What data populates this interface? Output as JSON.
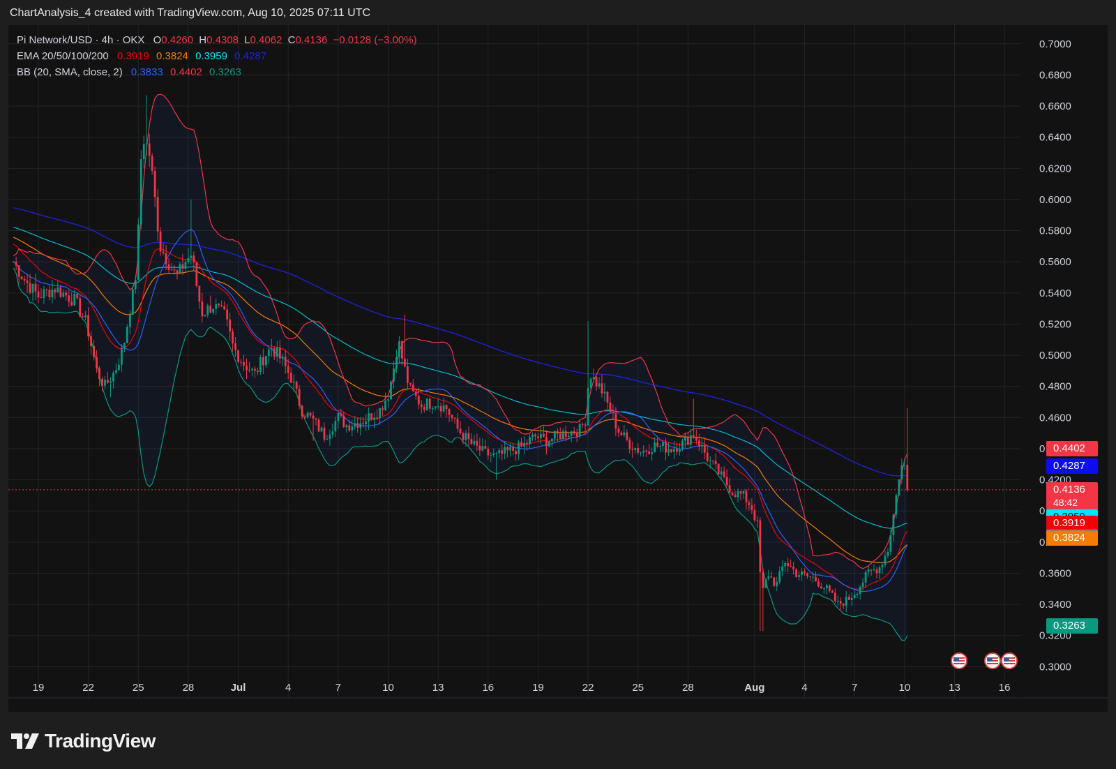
{
  "header": {
    "title": "ChartAnalysis_4 created with TradingView.com, Aug 10, 2025 07:11 UTC"
  },
  "legend": {
    "symbol": "Pi Network/USD · 4h · OKX",
    "o_label": "O",
    "o_value": "0.4260",
    "h_label": "H",
    "h_value": "0.4308",
    "l_label": "L",
    "l_value": "0.4062",
    "c_label": "C",
    "c_value": "0.4136",
    "change": "−0.0128 (−3.00%)",
    "ema_label": "EMA 20/50/100/200",
    "ema20": "0.3919",
    "ema50": "0.3824",
    "ema100": "0.3959",
    "ema200": "0.4287",
    "bb_label": "BB (20, SMA, close, 2)",
    "bb_basis": "0.3833",
    "bb_upper": "0.4402",
    "bb_lower": "0.3263"
  },
  "price_tags": [
    {
      "text": "0.4402",
      "value": 0.4402,
      "color": "#f23645"
    },
    {
      "text": "0.4287",
      "value": 0.4287,
      "color": "#0c0cf0"
    },
    {
      "text": "0.4136",
      "value": 0.4136,
      "color": "#f23645"
    },
    {
      "text": "0.3959",
      "value": 0.3959,
      "color": "#00e5ff",
      "dark_text": true
    },
    {
      "text": "0.3919",
      "value": 0.3919,
      "color": "#f20000"
    },
    {
      "text": "0.3833",
      "value": 0.3833,
      "color": "#2962ff"
    },
    {
      "text": "0.3824",
      "value": 0.3824,
      "color": "#f57c00"
    },
    {
      "text": "0.3263",
      "value": 0.3263,
      "color": "#089981"
    }
  ],
  "countdown": "48:42",
  "colors": {
    "bull": "#089981",
    "bear": "#f23645",
    "ema20": "#f20000",
    "ema50": "#f57c00",
    "ema100": "#00bcd4",
    "ema200": "#1e22d6",
    "bb_basis": "#2962ff",
    "bb_upper": "#f23645",
    "bb_lower": "#089981"
  },
  "chart_data": {
    "type": "candlestick",
    "y_ticks": [
      "0.3000",
      "0.3200",
      "0.3400",
      "0.3600",
      "0.3800",
      "0.4000",
      "0.4200",
      "0.4400",
      "0.4600",
      "0.4800",
      "0.5000",
      "0.5200",
      "0.5400",
      "0.5600",
      "0.5800",
      "0.6000",
      "0.6200",
      "0.6400",
      "0.6600",
      "0.6800",
      "0.7000"
    ],
    "ylim": [
      0.28,
      0.712
    ],
    "x_ticks": [
      "19",
      "22",
      "25",
      "28",
      "Jul",
      "4",
      "7",
      "10",
      "13",
      "16",
      "19",
      "22",
      "25",
      "28",
      "Aug",
      "4",
      "7",
      "10",
      "13",
      "16"
    ],
    "x_tick_days": [
      19,
      22,
      25,
      28,
      31,
      34,
      37,
      40,
      43,
      46,
      49,
      52,
      55,
      58,
      62,
      65,
      68,
      71,
      74,
      77
    ],
    "x_bold": [
      "Jul",
      "Aug"
    ],
    "xlim_days": [
      17.2,
      78
    ],
    "last_price": 0.4136,
    "close_keypoints": [
      [
        17.5,
        0.56
      ],
      [
        18.2,
        0.548
      ],
      [
        19.0,
        0.538
      ],
      [
        20.0,
        0.543
      ],
      [
        21.2,
        0.535
      ],
      [
        21.9,
        0.52
      ],
      [
        22.5,
        0.49
      ],
      [
        23.0,
        0.48
      ],
      [
        23.6,
        0.49
      ],
      [
        24.1,
        0.505
      ],
      [
        24.5,
        0.53
      ],
      [
        24.8,
        0.545
      ],
      [
        25.0,
        0.58
      ],
      [
        25.15,
        0.625
      ],
      [
        25.35,
        0.64
      ],
      [
        25.7,
        0.628
      ],
      [
        26.0,
        0.6
      ],
      [
        26.3,
        0.57
      ],
      [
        26.8,
        0.56
      ],
      [
        27.3,
        0.55
      ],
      [
        27.8,
        0.56
      ],
      [
        28.2,
        0.565
      ],
      [
        28.5,
        0.545
      ],
      [
        28.8,
        0.527
      ],
      [
        29.5,
        0.532
      ],
      [
        30.2,
        0.525
      ],
      [
        30.7,
        0.505
      ],
      [
        31.3,
        0.495
      ],
      [
        32.0,
        0.488
      ],
      [
        32.6,
        0.5
      ],
      [
        33.0,
        0.505
      ],
      [
        33.6,
        0.497
      ],
      [
        34.2,
        0.485
      ],
      [
        34.8,
        0.465
      ],
      [
        35.5,
        0.458
      ],
      [
        36.2,
        0.448
      ],
      [
        37.0,
        0.46
      ],
      [
        37.5,
        0.455
      ],
      [
        38.5,
        0.458
      ],
      [
        39.5,
        0.465
      ],
      [
        40.0,
        0.475
      ],
      [
        40.3,
        0.49
      ],
      [
        40.6,
        0.51
      ],
      [
        40.9,
        0.495
      ],
      [
        41.3,
        0.478
      ],
      [
        42.0,
        0.468
      ],
      [
        42.8,
        0.47
      ],
      [
        43.5,
        0.466
      ],
      [
        44.2,
        0.452
      ],
      [
        45.0,
        0.443
      ],
      [
        45.8,
        0.437
      ],
      [
        46.5,
        0.435
      ],
      [
        47.2,
        0.438
      ],
      [
        48.0,
        0.441
      ],
      [
        48.8,
        0.448
      ],
      [
        49.5,
        0.445
      ],
      [
        50.5,
        0.45
      ],
      [
        51.5,
        0.452
      ],
      [
        51.9,
        0.46
      ],
      [
        52.05,
        0.49
      ],
      [
        52.3,
        0.485
      ],
      [
        52.8,
        0.478
      ],
      [
        53.2,
        0.468
      ],
      [
        53.8,
        0.452
      ],
      [
        54.5,
        0.443
      ],
      [
        55.2,
        0.438
      ],
      [
        56.0,
        0.442
      ],
      [
        57.0,
        0.44
      ],
      [
        57.8,
        0.444
      ],
      [
        58.3,
        0.45
      ],
      [
        58.7,
        0.443
      ],
      [
        59.3,
        0.432
      ],
      [
        60.0,
        0.422
      ],
      [
        60.7,
        0.412
      ],
      [
        61.3,
        0.41
      ],
      [
        61.8,
        0.403
      ],
      [
        62.2,
        0.39
      ],
      [
        62.4,
        0.345
      ],
      [
        62.8,
        0.36
      ],
      [
        63.3,
        0.352
      ],
      [
        63.8,
        0.368
      ],
      [
        64.5,
        0.36
      ],
      [
        65.5,
        0.357
      ],
      [
        66.3,
        0.35
      ],
      [
        67.0,
        0.34
      ],
      [
        67.6,
        0.343
      ],
      [
        68.2,
        0.35
      ],
      [
        68.8,
        0.36
      ],
      [
        69.5,
        0.364
      ],
      [
        70.0,
        0.375
      ],
      [
        70.4,
        0.402
      ],
      [
        70.7,
        0.425
      ],
      [
        70.95,
        0.432
      ],
      [
        71.2,
        0.4136
      ]
    ],
    "wick_spikes": [
      [
        25.5,
        0.667,
        "up"
      ],
      [
        28.2,
        0.6,
        "up"
      ],
      [
        40.95,
        0.526,
        "up"
      ],
      [
        52.05,
        0.522,
        "up"
      ],
      [
        58.3,
        0.472,
        "up"
      ],
      [
        71.15,
        0.466,
        "up"
      ],
      [
        62.4,
        0.323,
        "down"
      ],
      [
        46.5,
        0.42,
        "down"
      ],
      [
        35.5,
        0.445,
        "down"
      ],
      [
        23.4,
        0.473,
        "down"
      ]
    ]
  }
}
